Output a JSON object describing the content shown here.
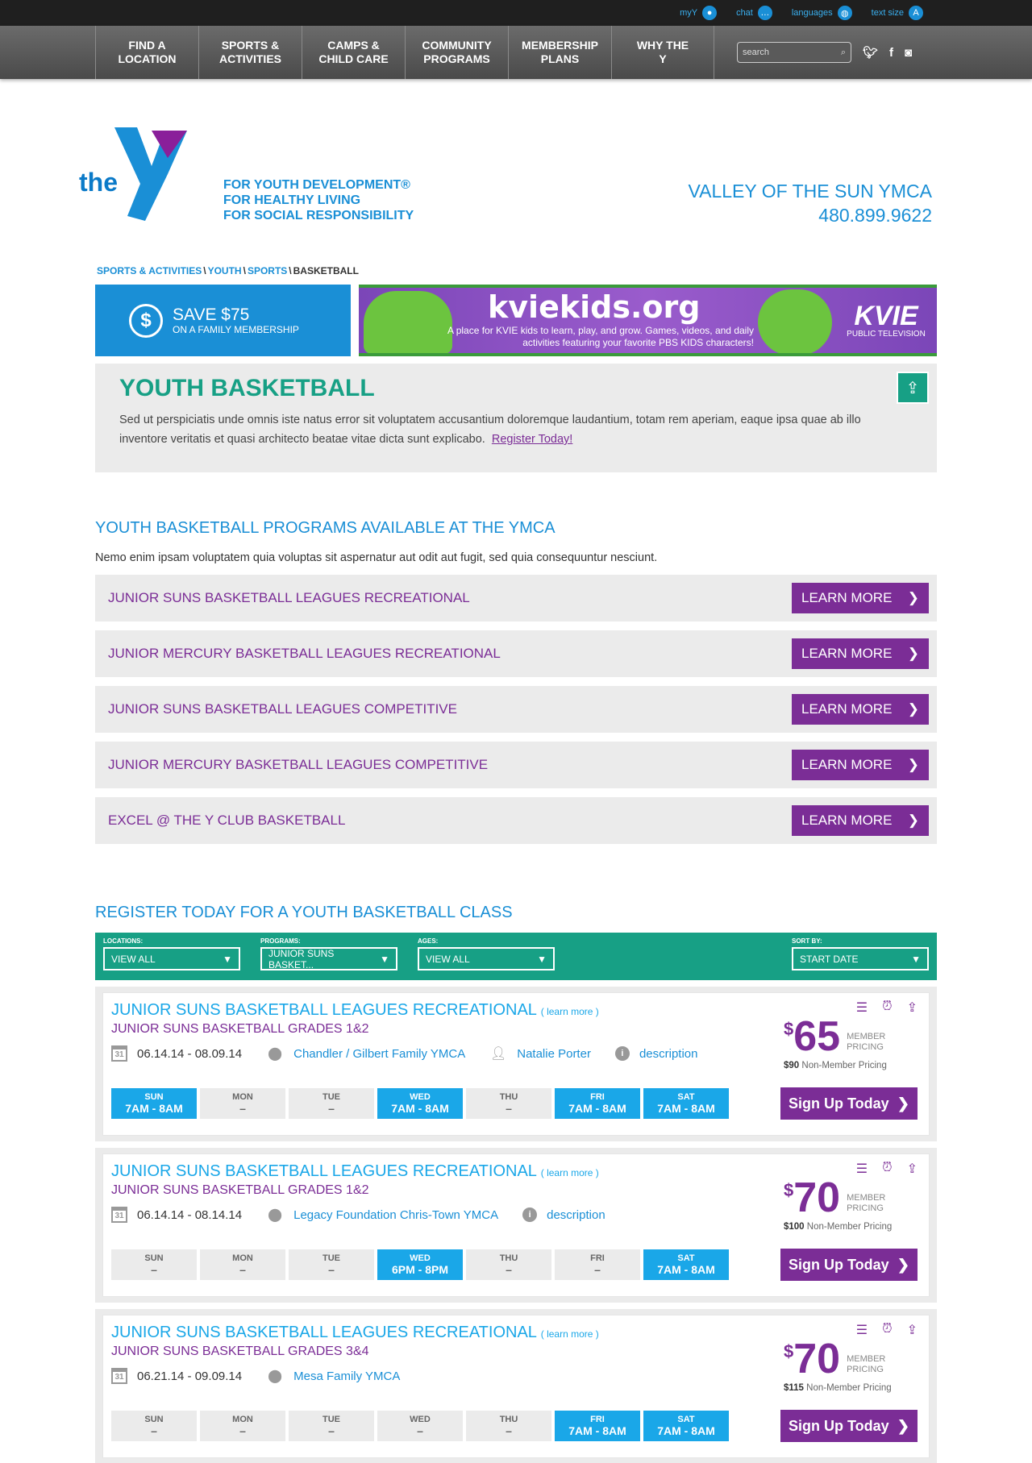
{
  "utility": {
    "my_y": "myY",
    "chat": "chat",
    "languages": "languages",
    "text_size": "text size"
  },
  "nav": {
    "items": [
      "FIND A\nLOCATION",
      "SPORTS &\nACTIVITIES",
      "CAMPS &\nCHILD CARE",
      "COMMUNITY\nPROGRAMS",
      "MEMBERSHIP\nPLANS",
      "WHY THE\nY"
    ],
    "search_placeholder": "search"
  },
  "header": {
    "logo_text": "the",
    "tagline": [
      "FOR YOUTH DEVELOPMENT®",
      "FOR HEALTHY LIVING",
      "FOR SOCIAL RESPONSIBILITY"
    ],
    "branch_name": "VALLEY OF THE SUN YMCA",
    "phone": "480.899.9622"
  },
  "breadcrumb": [
    "SPORTS & ACTIVITIES",
    "YOUTH",
    "SPORTS",
    "BASKETBALL"
  ],
  "promo": {
    "title": "SAVE $75",
    "subtitle": "ON A FAMILY MEMBERSHIP",
    "icon": "$"
  },
  "kvie": {
    "title": "kviekids.org",
    "description": "A place for KVIE kids to learn, play, and grow. Games, videos, and daily activities featuring your favorite PBS KIDS characters!",
    "logo": "KVIE",
    "logo_sub": "PUBLIC TELEVISION"
  },
  "intro": {
    "title": "YOUTH BASKETBALL",
    "text": "Sed ut perspiciatis unde omnis iste natus error sit voluptatem accusantium doloremque laudantium, totam rem aperiam, eaque ipsa quae ab illo inventore veritatis et quasi architecto beatae vitae dicta sunt explicabo.",
    "link": "Register Today!"
  },
  "programs": {
    "title": "YOUTH BASKETBALL PROGRAMS AVAILABLE AT THE YMCA",
    "lead": "Nemo enim ipsam voluptatem quia voluptas sit aspernatur aut odit aut fugit, sed quia consequuntur nesciunt.",
    "button_label": "LEARN MORE",
    "items": [
      "JUNIOR SUNS BASKETBALL LEAGUES RECREATIONAL",
      "JUNIOR MERCURY BASKETBALL LEAGUES RECREATIONAL",
      "JUNIOR SUNS BASKETBALL LEAGUES COMPETITIVE",
      "JUNIOR MERCURY BASKETBALL LEAGUES COMPETITIVE",
      "EXCEL @ THE Y CLUB BASKETBALL"
    ]
  },
  "register": {
    "title": "REGISTER TODAY FOR A YOUTH BASKETBALL CLASS",
    "filters": {
      "locations": {
        "label": "LOCATIONS:",
        "value": "VIEW ALL"
      },
      "programs": {
        "label": "PROGRAMS:",
        "value": "JUNIOR SUNS BASKET..."
      },
      "ages": {
        "label": "AGES:",
        "value": "VIEW ALL"
      },
      "sort": {
        "label": "SORT BY:",
        "value": "START DATE"
      }
    },
    "learn_more": "( learn more )",
    "member_pricing": "MEMBER PRICING",
    "signup_label": "Sign Up Today",
    "currency": "$",
    "non_member_suffix": "Non-Member Pricing",
    "day_names": [
      "SUN",
      "MON",
      "TUE",
      "WED",
      "THU",
      "FRI",
      "SAT"
    ],
    "classes": [
      {
        "title": "JUNIOR SUNS BASKETBALL LEAGUES RECREATIONAL",
        "sub": "JUNIOR SUNS BASKETBALL GRADES 1&2",
        "dates": "06.14.14 - 08.09.14",
        "location": "Chandler / Gilbert Family YMCA",
        "instructor": "Natalie Porter",
        "description": "description",
        "price": "65",
        "non_member": "$90",
        "days": [
          "7AM - 8AM",
          "–",
          "–",
          "7AM - 8AM",
          "–",
          "7AM - 8AM",
          "7AM - 8AM"
        ]
      },
      {
        "title": "JUNIOR SUNS BASKETBALL LEAGUES RECREATIONAL",
        "sub": "JUNIOR SUNS BASKETBALL GRADES 1&2",
        "dates": "06.14.14 - 08.14.14",
        "location": "Legacy Foundation Chris-Town YMCA",
        "instructor": "",
        "description": "description",
        "price": "70",
        "non_member": "$100",
        "days": [
          "–",
          "–",
          "–",
          "6PM - 8PM",
          "–",
          "–",
          "7AM - 8AM"
        ]
      },
      {
        "title": "JUNIOR SUNS BASKETBALL LEAGUES RECREATIONAL",
        "sub": "JUNIOR SUNS BASKETBALL GRADES 3&4",
        "dates": "06.21.14 - 09.09.14",
        "location": "Mesa Family YMCA",
        "instructor": "",
        "description": "",
        "price": "70",
        "non_member": "$115",
        "days": [
          "–",
          "–",
          "–",
          "–",
          "–",
          "7AM - 8AM",
          "7AM - 8AM"
        ]
      }
    ]
  },
  "colors": {
    "blue": "#1a8fd6",
    "purple": "#7b2d96",
    "teal": "#17a085",
    "gray": "#ebebeb"
  }
}
